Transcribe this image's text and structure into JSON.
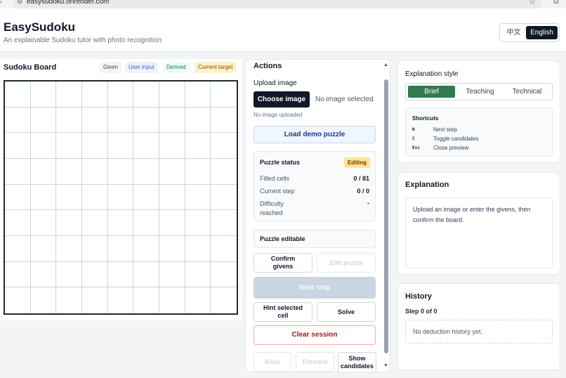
{
  "browser": {
    "url": "easysudoku.onrender.com"
  },
  "header": {
    "title": "EasySudoku",
    "subtitle": "An explainable Sudoku tutor with photo recognition",
    "languages": {
      "zh": "中文",
      "en": "English"
    }
  },
  "board": {
    "title": "Sudoku Board",
    "legend": {
      "given": "Given",
      "user": "User input",
      "derived": "Derived",
      "target": "Current target"
    }
  },
  "actions": {
    "title": "Actions",
    "upload_label": "Upload image",
    "choose_button": "Choose image",
    "no_image_selected": "No image selected",
    "no_image_uploaded": "No image uploaded",
    "load_demo": "Load demo puzzle",
    "status": {
      "title": "Puzzle status",
      "badge": "Editing",
      "filled_label": "Filled cells",
      "filled_value": "0 / 81",
      "step_label": "Current step",
      "step_value": "0 / 0",
      "difficulty_label": "Difficulty reached",
      "difficulty_value": "-"
    },
    "editable": "Puzzle editable",
    "confirm_givens": "Confirm givens",
    "edit_puzzle": "Edit puzzle",
    "next_step": "Next step",
    "hint_selected": "Hint selected cell",
    "solve": "Solve",
    "clear_session": "Clear session",
    "back": "Back",
    "forward": "Forward",
    "show_candidates": "Show candidates"
  },
  "explanation_style": {
    "title": "Explanation style",
    "options": [
      "Brief",
      "Teaching",
      "Technical"
    ],
    "selected": "Brief",
    "shortcuts": {
      "title": "Shortcuts",
      "items": [
        {
          "key": "N",
          "desc": "Next step"
        },
        {
          "key": "C",
          "desc": "Toggle candidates"
        },
        {
          "key": "Esc",
          "desc": "Close preview"
        }
      ]
    }
  },
  "explanation": {
    "title": "Explanation",
    "text": "Upload an image or enter the givens, then confirm the board."
  },
  "history": {
    "title": "History",
    "step": "Step 0 of 0",
    "empty": "No deduction history yet."
  }
}
